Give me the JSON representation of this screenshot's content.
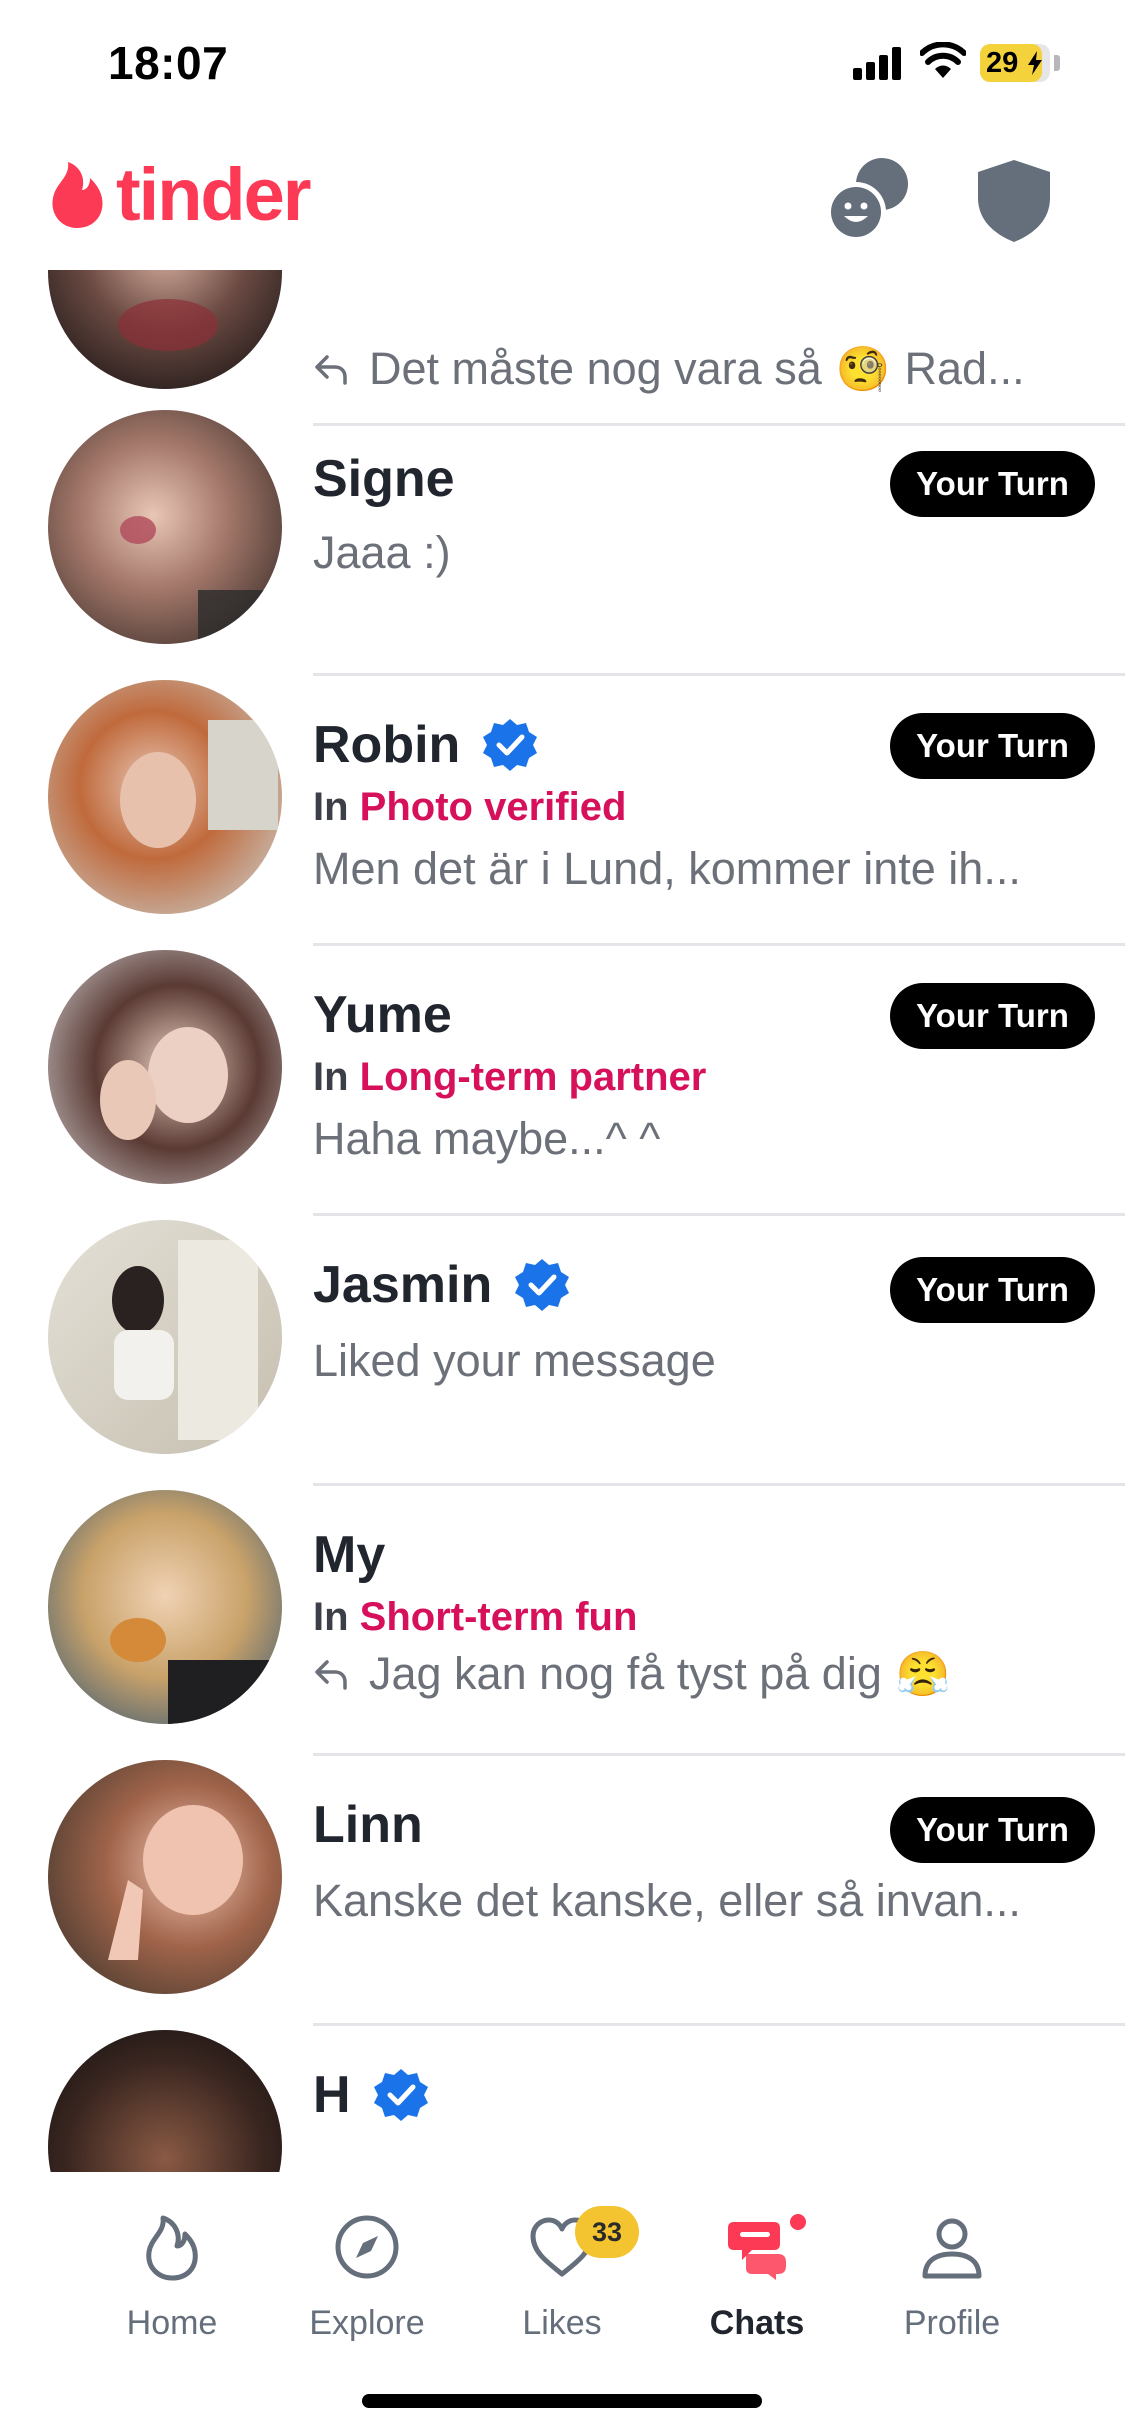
{
  "status_bar": {
    "time": "18:07",
    "battery": "29"
  },
  "header": {
    "logo_text": "tinder"
  },
  "colors": {
    "brand": "#fd3a55",
    "intent": "#d6105a",
    "verified": "#1a73e8",
    "badge_bg": "#000000",
    "likes_badge": "#f4c430"
  },
  "chats": [
    {
      "name": "",
      "message": "Det måste nog vara så",
      "emoji": "🧐",
      "message_tail": "Rad...",
      "replied": true
    },
    {
      "name": "Signe",
      "message": "Jaaa :)",
      "badge": "Your Turn"
    },
    {
      "name": "Robin",
      "verified": true,
      "intent_prefix": "In",
      "intent": "Photo verified",
      "message": "Men det är i Lund, kommer inte ih...",
      "badge": "Your Turn"
    },
    {
      "name": "Yume",
      "intent_prefix": "In",
      "intent": "Long-term partner",
      "message": "Haha maybe...^ ^",
      "badge": "Your Turn"
    },
    {
      "name": "Jasmin",
      "verified": true,
      "message": "Liked your message",
      "badge": "Your Turn"
    },
    {
      "name": "My",
      "intent_prefix": "In",
      "intent": "Short-term fun",
      "message": "Jag kan nog få tyst på dig",
      "emoji": "😤",
      "replied": true
    },
    {
      "name": "Linn",
      "message": "Kanske det kanske, eller så invan...",
      "badge": "Your Turn"
    },
    {
      "name": "H",
      "verified": true
    }
  ],
  "tabs": [
    {
      "label": "Home",
      "icon": "flame-outline-icon"
    },
    {
      "label": "Explore",
      "icon": "compass-icon"
    },
    {
      "label": "Likes",
      "icon": "heart-outline-icon",
      "badge": "33"
    },
    {
      "label": "Chats",
      "icon": "chat-bubbles-icon",
      "active": true
    },
    {
      "label": "Profile",
      "icon": "person-outline-icon"
    }
  ]
}
